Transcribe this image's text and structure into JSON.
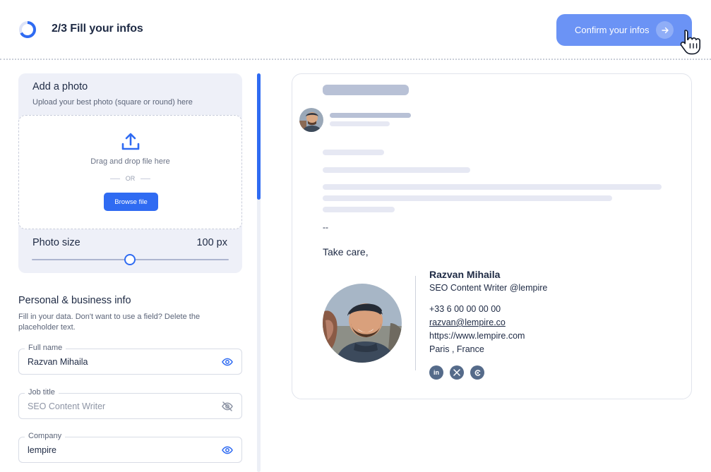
{
  "header": {
    "step_title": "2/3 Fill your infos",
    "confirm_label": "Confirm your infos",
    "progress_fraction": 0.667
  },
  "photo": {
    "title": "Add a photo",
    "subtitle": "Upload your best photo (square or round) here",
    "drop_text": "Drag and drop file here",
    "or_text": "OR",
    "browse_label": "Browse file",
    "size_label": "Photo size",
    "size_value": "100 px",
    "slider_fraction": 0.5
  },
  "personal": {
    "title": "Personal & business info",
    "description": "Fill in your data. Don't want to use a field? Delete the placeholder text.",
    "fields": [
      {
        "label": "Full name",
        "value": "Razvan Mihaila",
        "visible": true
      },
      {
        "label": "Job title",
        "value": "SEO Content Writer",
        "visible": false
      },
      {
        "label": "Company",
        "value": "lempire",
        "visible": true
      }
    ]
  },
  "preview": {
    "separator": "--",
    "closing": "Take care,",
    "signature": {
      "name": "Razvan Mihaila",
      "role": "SEO Content Writer @lempire",
      "phone": "+33 6 00 00 00 00",
      "email": "razvan@lempire.co",
      "website": "https://www.lempire.com",
      "location": "Paris , France",
      "socials": [
        "linkedin-icon",
        "x-icon",
        "lempire-icon"
      ]
    }
  },
  "colors": {
    "accent": "#2f6bf2",
    "confirm_button": "#6b93f5",
    "skeleton_dark": "#b8c1d6",
    "skeleton_light": "#e6e8f3"
  }
}
